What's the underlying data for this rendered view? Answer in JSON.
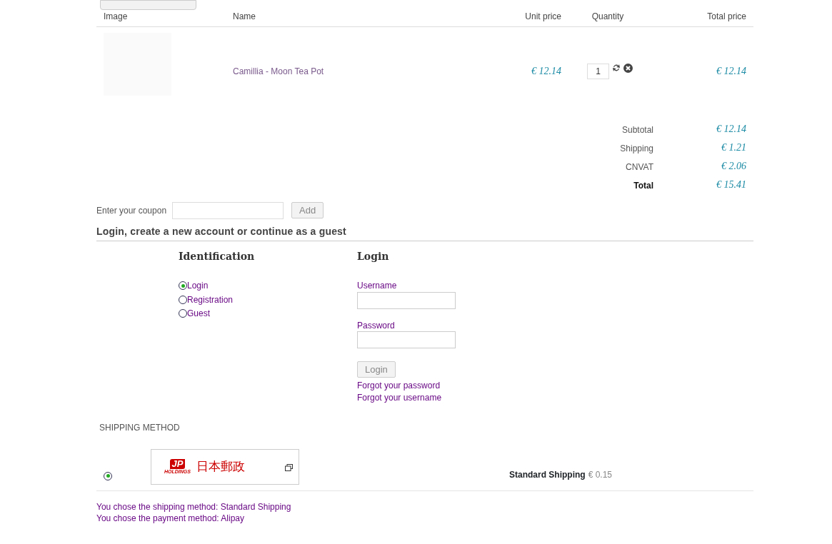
{
  "cart": {
    "columns": [
      "Image",
      "Name",
      "Unit price",
      "Quantity",
      "Total price"
    ],
    "items": [
      {
        "name": "Camillia - Moon Tea Pot",
        "unit_price": "€ 12.14",
        "quantity": "1",
        "total_price": "€ 12.14"
      }
    ],
    "totals": [
      {
        "label": "Subtotal",
        "value": "€ 12.14",
        "kind": "normal"
      },
      {
        "label": "Shipping",
        "value": "€ 1.21",
        "kind": "normal"
      },
      {
        "label": "CNVAT",
        "value": "€ 2.06",
        "kind": "normal"
      },
      {
        "label": "Total",
        "value": "€ 15.41",
        "kind": "grand"
      }
    ]
  },
  "coupon": {
    "label": "Enter your coupon",
    "button": "Add"
  },
  "login_section": {
    "heading": "Login, create a new account or continue as a guest",
    "identification": {
      "title": "Identification",
      "options": [
        {
          "label": "Login",
          "selected": true
        },
        {
          "label": "Registration",
          "selected": false
        },
        {
          "label": "Guest",
          "selected": false
        }
      ]
    },
    "login": {
      "title": "Login",
      "username_label": "Username",
      "password_label": "Password",
      "button": "Login",
      "links": [
        "Forgot your password",
        "Forgot your username"
      ]
    }
  },
  "shipping": {
    "heading": "SHIPPING METHOD",
    "methods": [
      {
        "selected": true,
        "logo_mark": "JP",
        "logo_sub": "HOLDINGS",
        "logo_text": "日本郵政",
        "name": "Standard Shipping",
        "price": "€ 0.15"
      }
    ]
  },
  "summary": [
    "You chose the shipping method: Standard Shipping",
    "You chose the payment method: Alipay"
  ]
}
